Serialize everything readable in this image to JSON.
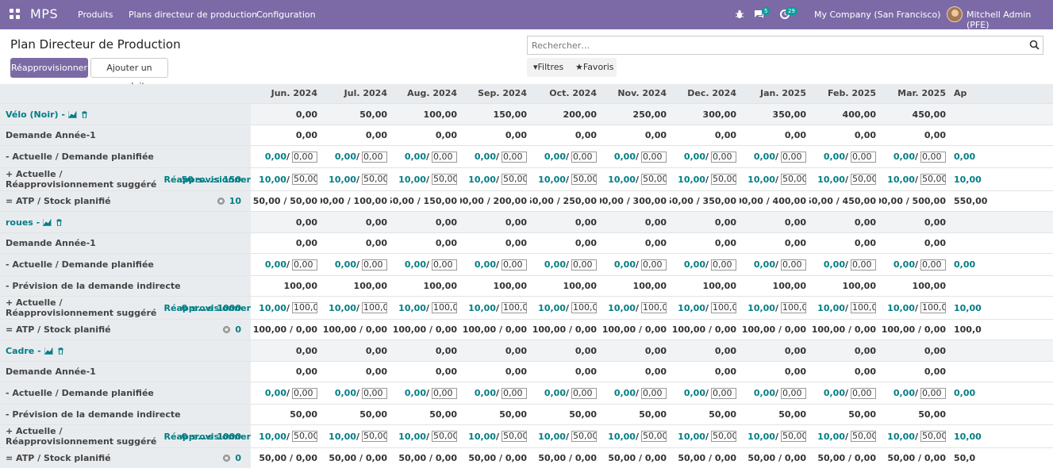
{
  "nav": {
    "app_name": "MPS",
    "menu": [
      "Produits",
      "Plans directeur de production",
      "Configuration"
    ],
    "badges": {
      "chat": "5",
      "activity": "29"
    },
    "company": "My Company (San Francisco)",
    "user": "Mitchell Admin (PFE)"
  },
  "page": {
    "title": "Plan Directeur de Production",
    "btn_replenish": "Réapprovisionner",
    "btn_add_product": "Ajouter un produit",
    "search_placeholder": "Rechercher…",
    "filters": "Filtres",
    "favorites": "Favoris"
  },
  "months": [
    "Jun. 2024",
    "Jul. 2024",
    "Aug. 2024",
    "Sep. 2024",
    "Oct. 2024",
    "Nov. 2024",
    "Dec. 2024",
    "Jan. 2025",
    "Feb. 2025",
    "Mar. 2025",
    "Ap"
  ],
  "labels": {
    "demand_prev_year": "Demande Année-1",
    "actual_demand": "- Actuelle / Demande planifiée",
    "indirect": "- Prévision de la demande indirecte",
    "replenish": "+ Actuelle / Réapprovisionnement suggéré",
    "replenish_link": "Réapprovisionner",
    "atp": "= ATP / Stock planifié"
  },
  "products": [
    {
      "name": "Vélo (Noir) -",
      "totals": [
        "0,00",
        "50,00",
        "100,00",
        "150,00",
        "200,00",
        "250,00",
        "300,00",
        "350,00",
        "400,00",
        "450,00",
        ""
      ],
      "demand_prev": [
        "0,00",
        "0,00",
        "0,00",
        "0,00",
        "0,00",
        "0,00",
        "0,00",
        "0,00",
        "0,00",
        "0,00",
        ""
      ],
      "actual_demand": {
        "actual": [
          "0,00",
          "0,00",
          "0,00",
          "0,00",
          "0,00",
          "0,00",
          "0,00",
          "0,00",
          "0,00",
          "0,00",
          "0,00"
        ],
        "planned": [
          "0,00",
          "0,00",
          "0,00",
          "0,00",
          "0,00",
          "0,00",
          "0,00",
          "0,00",
          "0,00",
          "0,00",
          ""
        ]
      },
      "indirect": null,
      "replenish_bounds": "50 ≤…≤ 150",
      "replenish": {
        "actual": [
          "10,00",
          "10,00",
          "10,00",
          "10,00",
          "10,00",
          "10,00",
          "10,00",
          "10,00",
          "10,00",
          "10,00",
          "10,00"
        ],
        "suggested": [
          "50,00",
          "50,00",
          "50,00",
          "50,00",
          "50,00",
          "50,00",
          "50,00",
          "50,00",
          "50,00",
          "50,00",
          ""
        ]
      },
      "stock": "10",
      "atp": [
        "50,00 / 50,00",
        "100,00 / 100,00",
        "150,00 / 150,00",
        "200,00 / 200,00",
        "250,00 / 250,00",
        "300,00 / 300,00",
        "350,00 / 350,00",
        "400,00 / 400,00",
        "450,00 / 450,00",
        "500,00 / 500,00",
        "550,00"
      ]
    },
    {
      "name": "roues -",
      "totals": [
        "0,00",
        "0,00",
        "0,00",
        "0,00",
        "0,00",
        "0,00",
        "0,00",
        "0,00",
        "0,00",
        "0,00",
        ""
      ],
      "demand_prev": [
        "0,00",
        "0,00",
        "0,00",
        "0,00",
        "0,00",
        "0,00",
        "0,00",
        "0,00",
        "0,00",
        "0,00",
        ""
      ],
      "actual_demand": {
        "actual": [
          "0,00",
          "0,00",
          "0,00",
          "0,00",
          "0,00",
          "0,00",
          "0,00",
          "0,00",
          "0,00",
          "0,00",
          "0,00"
        ],
        "planned": [
          "0,00",
          "0,00",
          "0,00",
          "0,00",
          "0,00",
          "0,00",
          "0,00",
          "0,00",
          "0,00",
          "0,00",
          ""
        ]
      },
      "indirect": [
        "100,00",
        "100,00",
        "100,00",
        "100,00",
        "100,00",
        "100,00",
        "100,00",
        "100,00",
        "100,00",
        "100,00",
        ""
      ],
      "replenish_bounds": "0 ≤…≤ 1000",
      "replenish": {
        "actual": [
          "10,00",
          "10,00",
          "10,00",
          "10,00",
          "10,00",
          "10,00",
          "10,00",
          "10,00",
          "10,00",
          "10,00",
          "10,00"
        ],
        "suggested": [
          "100,0",
          "100,0",
          "100,0",
          "100,0",
          "100,0",
          "100,0",
          "100,0",
          "100,0",
          "100,0",
          "100,0",
          ""
        ]
      },
      "stock": "0",
      "atp": [
        "100,00 / 0,00",
        "100,00 / 0,00",
        "100,00 / 0,00",
        "100,00 / 0,00",
        "100,00 / 0,00",
        "100,00 / 0,00",
        "100,00 / 0,00",
        "100,00 / 0,00",
        "100,00 / 0,00",
        "100,00 / 0,00",
        "100,0"
      ]
    },
    {
      "name": "Cadre -",
      "totals": [
        "0,00",
        "0,00",
        "0,00",
        "0,00",
        "0,00",
        "0,00",
        "0,00",
        "0,00",
        "0,00",
        "0,00",
        ""
      ],
      "demand_prev": [
        "0,00",
        "0,00",
        "0,00",
        "0,00",
        "0,00",
        "0,00",
        "0,00",
        "0,00",
        "0,00",
        "0,00",
        ""
      ],
      "actual_demand": {
        "actual": [
          "0,00",
          "0,00",
          "0,00",
          "0,00",
          "0,00",
          "0,00",
          "0,00",
          "0,00",
          "0,00",
          "0,00",
          "0,00"
        ],
        "planned": [
          "0,00",
          "0,00",
          "0,00",
          "0,00",
          "0,00",
          "0,00",
          "0,00",
          "0,00",
          "0,00",
          "0,00",
          ""
        ]
      },
      "indirect": [
        "50,00",
        "50,00",
        "50,00",
        "50,00",
        "50,00",
        "50,00",
        "50,00",
        "50,00",
        "50,00",
        "50,00",
        ""
      ],
      "replenish_bounds": "0 ≤…≤ 1000",
      "replenish": {
        "actual": [
          "10,00",
          "10,00",
          "10,00",
          "10,00",
          "10,00",
          "10,00",
          "10,00",
          "10,00",
          "10,00",
          "10,00",
          "10,00"
        ],
        "suggested": [
          "50,00",
          "50,00",
          "50,00",
          "50,00",
          "50,00",
          "50,00",
          "50,00",
          "50,00",
          "50,00",
          "50,00",
          ""
        ]
      },
      "stock": "0",
      "atp": [
        "50,00 / 0,00",
        "50,00 / 0,00",
        "50,00 / 0,00",
        "50,00 / 0,00",
        "50,00 / 0,00",
        "50,00 / 0,00",
        "50,00 / 0,00",
        "50,00 / 0,00",
        "50,00 / 0,00",
        "50,00 / 0,00",
        "50,0"
      ]
    }
  ]
}
